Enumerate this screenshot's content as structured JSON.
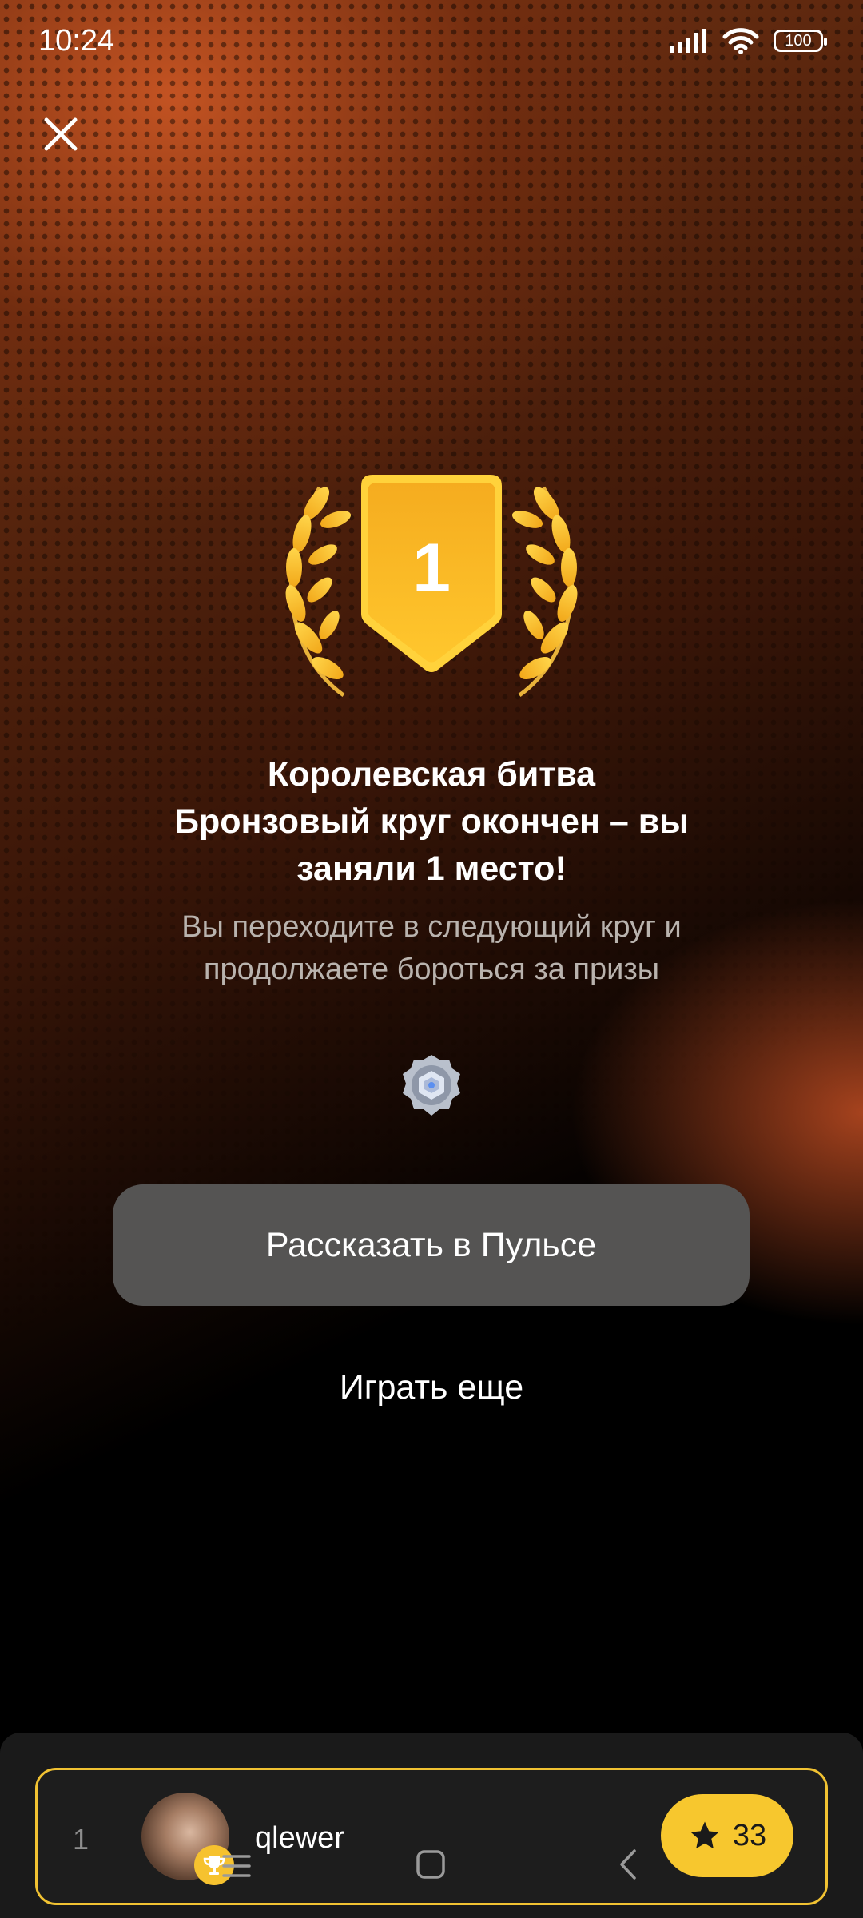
{
  "status_bar": {
    "time": "10:24",
    "battery": "100"
  },
  "trophy": {
    "place": "1"
  },
  "result": {
    "title_line1": "Королевская битва",
    "title_line2": "Бронзовый круг окончен – вы",
    "title_line3": "заняли 1 место!",
    "subtitle_line1": "Вы переходите в следующий круг и",
    "subtitle_line2": "продолжаете бороться за призы"
  },
  "actions": {
    "share_label": "Рассказать в Пульсе",
    "play_again_label": "Играть еще"
  },
  "leaderboard_entry": {
    "rank": "1",
    "username": "qlewer",
    "score": "33"
  },
  "colors": {
    "accent": "#f7c72e",
    "background": "#000000",
    "button": "#555453",
    "glow": "#c85523"
  },
  "icons": [
    "close-icon",
    "signal-icon",
    "wifi-icon",
    "battery-icon",
    "laurel-icon",
    "shield-icon",
    "level-badge-icon",
    "trophy-icon",
    "star-icon",
    "menu-icon",
    "home-icon",
    "back-icon"
  ]
}
